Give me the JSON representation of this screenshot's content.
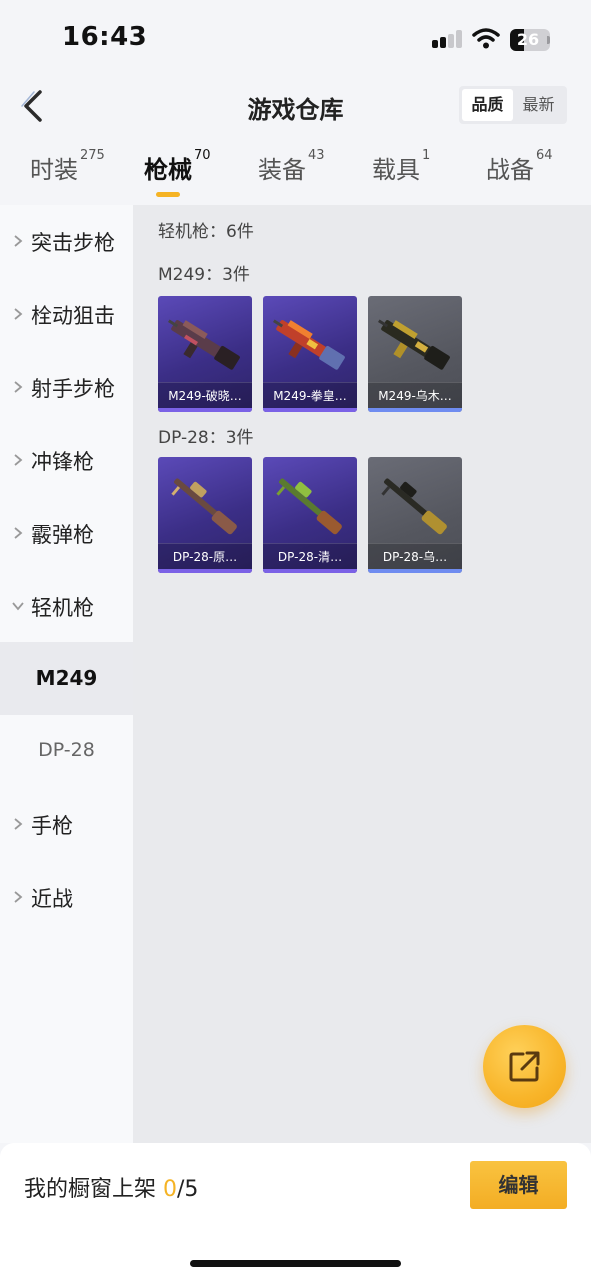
{
  "status_bar": {
    "time": "16:43",
    "battery": "26",
    "icons": [
      "signal-icon",
      "wifi-icon",
      "battery-icon"
    ]
  },
  "header": {
    "title": "游戏仓库",
    "back_icon": "chevron-left-icon",
    "sort_options": [
      {
        "label": "品质",
        "active": true
      },
      {
        "label": "最新",
        "active": false
      }
    ]
  },
  "tabs": [
    {
      "label": "时装",
      "count": "275",
      "active": false
    },
    {
      "label": "枪械",
      "count": "70",
      "active": true
    },
    {
      "label": "装备",
      "count": "43",
      "active": false
    },
    {
      "label": "载具",
      "count": "1",
      "active": false
    },
    {
      "label": "战备",
      "count": "64",
      "active": false
    }
  ],
  "sidebar": {
    "categories": [
      {
        "label": "突击步枪",
        "expanded": false
      },
      {
        "label": "栓动狙击",
        "expanded": false
      },
      {
        "label": "射手步枪",
        "expanded": false
      },
      {
        "label": "冲锋枪",
        "expanded": false
      },
      {
        "label": "霰弹枪",
        "expanded": false
      },
      {
        "label": "轻机枪",
        "expanded": true
      },
      {
        "label": "手枪",
        "expanded": false
      },
      {
        "label": "近战",
        "expanded": false
      }
    ],
    "subitems": [
      {
        "label": "M249",
        "active": true
      },
      {
        "label": "DP-28",
        "active": false
      }
    ]
  },
  "content": {
    "category_summary": "轻机枪：6件",
    "groups": [
      {
        "title": "M249：3件",
        "items": [
          {
            "label": "M249-破晓…",
            "rarity_color": "#4a3a9e"
          },
          {
            "label": "M249-拳皇…",
            "rarity_color": "#4a3a9e"
          },
          {
            "label": "M249-乌木…",
            "rarity_color": "#5a5c64"
          }
        ]
      },
      {
        "title": "DP-28：3件",
        "items": [
          {
            "label": "DP-28-原…",
            "rarity_color": "#4a3a9e"
          },
          {
            "label": "DP-28-清…",
            "rarity_color": "#4a3a9e"
          },
          {
            "label": "DP-28-乌…",
            "rarity_color": "#5a5c64"
          }
        ]
      }
    ]
  },
  "fab": {
    "icon": "share-icon"
  },
  "bottom_bar": {
    "shelf_label": "我的橱窗上架",
    "shelf_count": "0",
    "shelf_max": "/5",
    "edit_label": "编辑"
  },
  "colors": {
    "accent": "#f5b324",
    "purple_rarity": "#4a3a9e",
    "grey_rarity": "#5a5c64"
  }
}
